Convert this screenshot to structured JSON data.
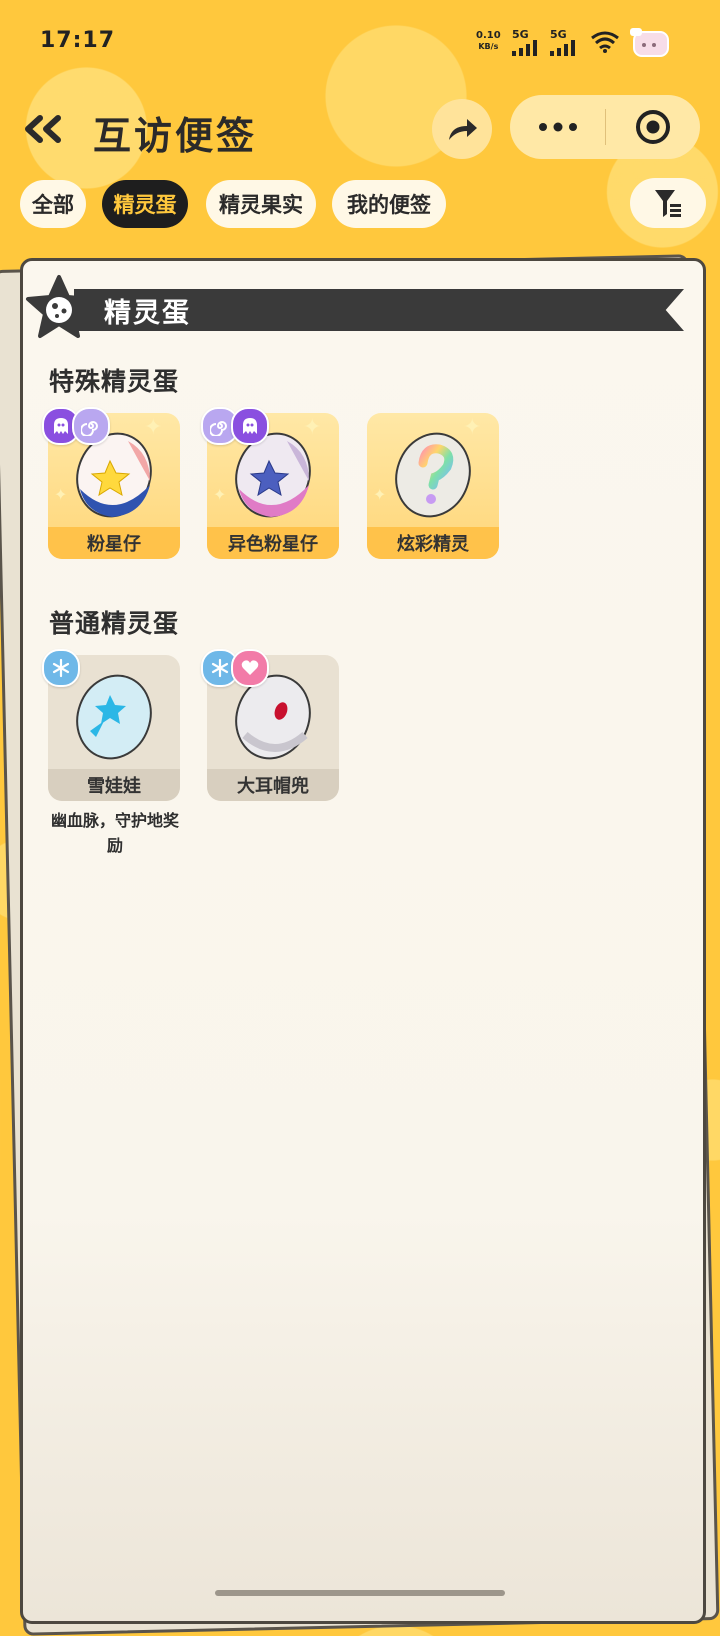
{
  "status_bar": {
    "time": "17:17",
    "net_speed_value": "0.10",
    "net_speed_unit": "KB/s",
    "sim1_label": "5G",
    "sim2_label": "5G"
  },
  "header": {
    "title": "互访便签",
    "back_icon": "double-chevron-left-icon",
    "share_icon": "share-arrow-icon",
    "more_icon": "more-dots-icon",
    "close_icon": "target-close-icon"
  },
  "tabs": [
    {
      "label": "全部",
      "active": false
    },
    {
      "label": "精灵蛋",
      "active": true
    },
    {
      "label": "精灵果实",
      "active": false
    },
    {
      "label": "我的便签",
      "active": false
    }
  ],
  "filter_icon": "funnel-filter-icon",
  "section": {
    "title": "精灵蛋",
    "groups": [
      {
        "title": "特殊精灵蛋",
        "items": [
          {
            "name": "粉星仔",
            "badges": [
              "ghost",
              "spiral"
            ]
          },
          {
            "name": "异色粉星仔",
            "badges": [
              "spiral",
              "ghost"
            ]
          },
          {
            "name": "炫彩精灵",
            "badges": []
          }
        ]
      },
      {
        "title": "普通精灵蛋",
        "items": [
          {
            "name": "雪娃娃",
            "badges": [
              "ice"
            ],
            "note": "幽血脉，守护地奖励"
          },
          {
            "name": "大耳帽兜",
            "badges": [
              "ice",
              "heart"
            ]
          }
        ]
      }
    ]
  },
  "colors": {
    "background": "#FFC83D",
    "active_tab_bg": "#1E1E1E",
    "active_tab_text": "#FFC83D",
    "special_card": "#FFD679",
    "normal_card": "#E9E1D2"
  }
}
